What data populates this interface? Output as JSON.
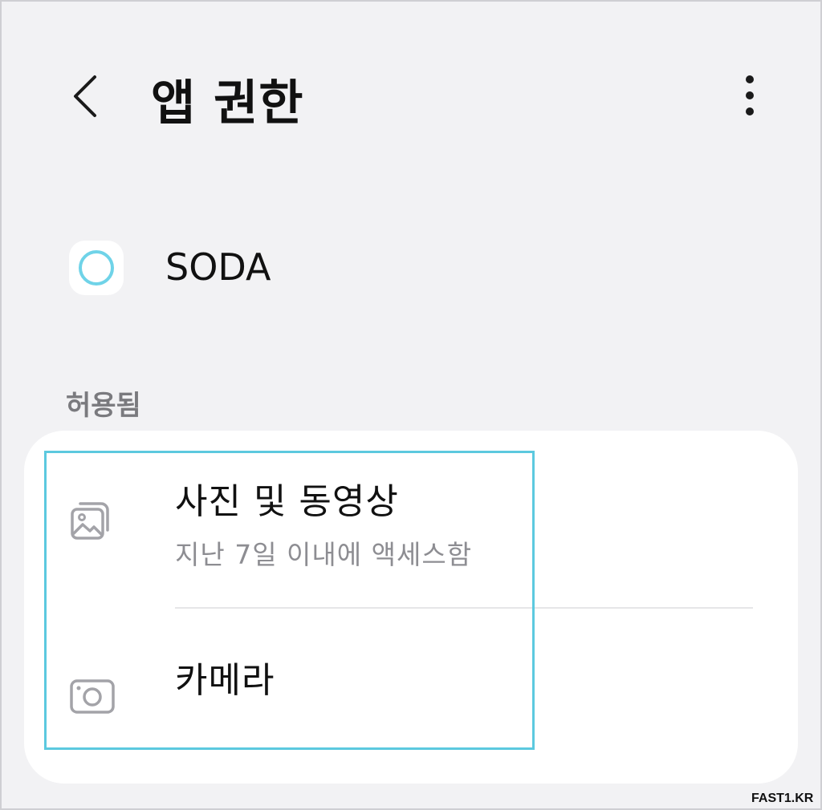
{
  "header": {
    "title": "앱 권한",
    "back_icon": "chevron-left-icon",
    "more_icon": "more-vertical-icon"
  },
  "app": {
    "name": "SODA",
    "icon_color": "#6fd3e8"
  },
  "section": {
    "label": "허용됨"
  },
  "permissions": [
    {
      "icon": "photo-gallery-icon",
      "title": "사진 및 동영상",
      "subtitle": "지난 7일 이내에 액세스함"
    },
    {
      "icon": "camera-icon",
      "title": "카메라"
    }
  ],
  "highlight_color": "#5cc9df",
  "watermark": "FAST1.KR"
}
